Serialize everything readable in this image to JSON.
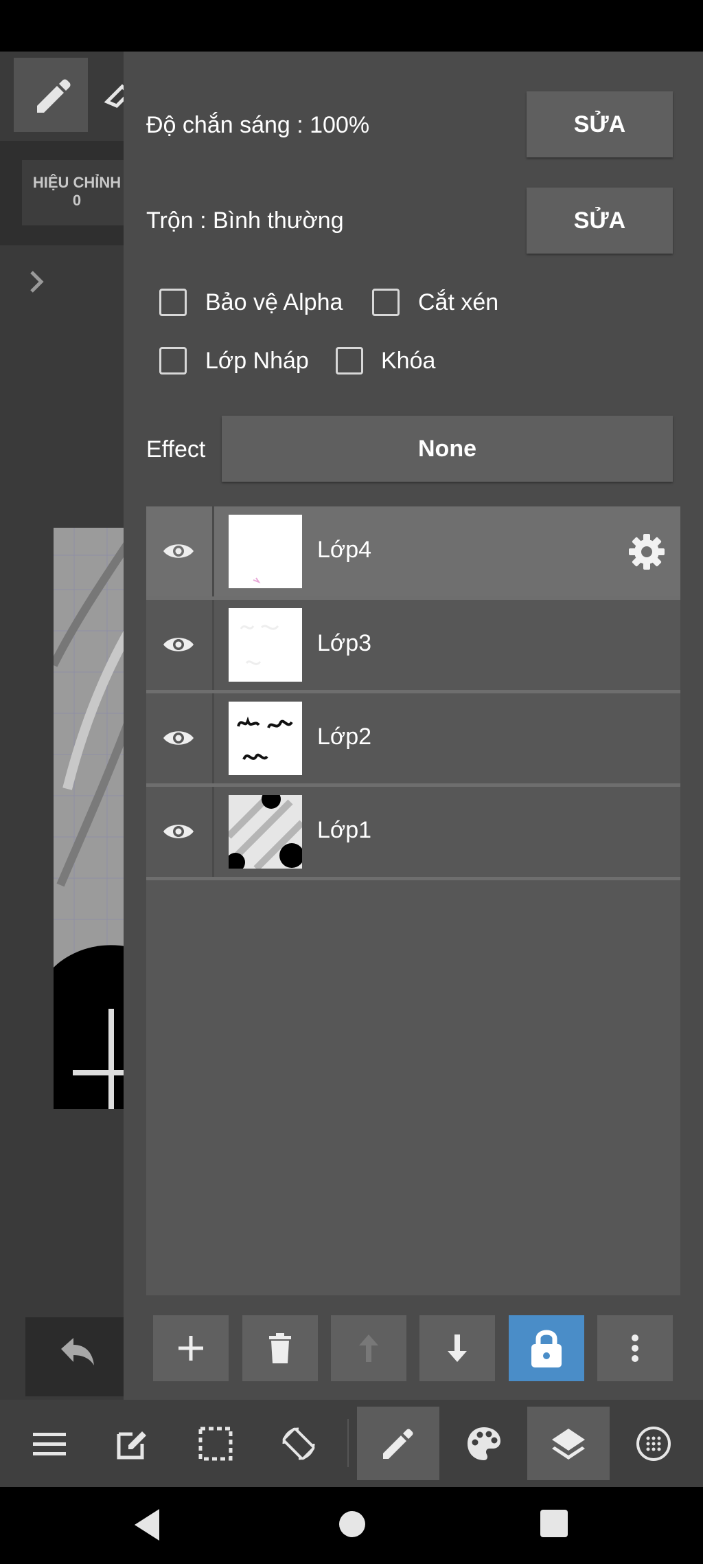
{
  "background_app": {
    "adjust_label_line1": "HIỆU CHỈNH",
    "adjust_label_line2": "0"
  },
  "layer_panel": {
    "opacity_label": "Độ chắn sáng : 100%",
    "opacity_edit_label": "SỬA",
    "blend_label": "Trộn : Bình thường",
    "blend_edit_label": "SỬA",
    "checkboxes": {
      "protect_alpha": "Bảo vệ Alpha",
      "clipping": "Cắt xén",
      "draft_layer": "Lớp Nháp",
      "lock": "Khóa"
    },
    "effect_label": "Effect",
    "effect_value": "None",
    "layers": [
      {
        "name": "Lớp4",
        "visible": true,
        "selected": true
      },
      {
        "name": "Lớp3",
        "visible": true,
        "selected": false
      },
      {
        "name": "Lớp2",
        "visible": true,
        "selected": false
      },
      {
        "name": "Lớp1",
        "visible": true,
        "selected": false
      }
    ],
    "actions": [
      "add-layer",
      "delete-layer",
      "move-up",
      "move-down",
      "lock-alpha",
      "more"
    ]
  },
  "toolbar": {
    "items": [
      "menu",
      "edit",
      "selection",
      "rotate",
      "pen",
      "palette",
      "layers",
      "material"
    ],
    "highlighted": [
      "pen",
      "layers"
    ]
  },
  "colors": {
    "panel_bg": "#4b4b4b",
    "list_bg": "#575757",
    "selected_row": "#6f6f6f",
    "accent_lock": "#4a8dc8",
    "button_bg": "#5f5f5f"
  }
}
